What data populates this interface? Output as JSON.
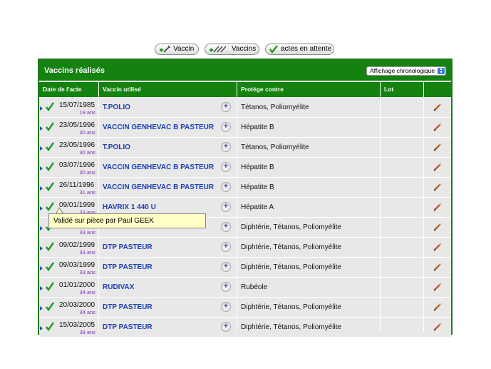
{
  "toolbar": {
    "vaccin_label": "Vaccin",
    "vaccins_label": "Vaccins",
    "attente_label": "actes en attente"
  },
  "panel": {
    "title": "Vaccins réalisés",
    "sort_select": "Affichage chronologique"
  },
  "columns": {
    "date": "Date de l'acte",
    "vaccine": "Vaccin utilisé",
    "protects": "Protège contre",
    "lot": "Lot"
  },
  "rows": [
    {
      "date": "15/07/1985",
      "age": "19 ans",
      "vaccine": "T.POLIO",
      "protects": "Tétanos, Poliomyélite",
      "lot": ""
    },
    {
      "date": "23/05/1996",
      "age": "30 ans",
      "vaccine": "VACCIN GENHEVAC B PASTEUR",
      "protects": "Hépatite B",
      "lot": ""
    },
    {
      "date": "23/05/1996",
      "age": "30 ans",
      "vaccine": "T.POLIO",
      "protects": "Tétanos, Poliomyélite",
      "lot": ""
    },
    {
      "date": "03/07/1996",
      "age": "30 ans",
      "vaccine": "VACCIN GENHEVAC B PASTEUR",
      "protects": "Hépatite B",
      "lot": ""
    },
    {
      "date": "26/11/1996",
      "age": "31 ans",
      "vaccine": "VACCIN GENHEVAC B PASTEUR",
      "protects": "Hépatite B",
      "lot": ""
    },
    {
      "date": "09/01/1999",
      "age": "33 ans",
      "vaccine": "HAVRIX 1 440 U",
      "protects": "Hépatite A",
      "lot": ""
    },
    {
      "date": "",
      "age": "33 ans",
      "vaccine": "",
      "protects": "Diphtérie, Tétanos, Poliomyélite",
      "lot": ""
    },
    {
      "date": "09/02/1999",
      "age": "33 ans",
      "vaccine": "DTP PASTEUR",
      "protects": "Diphtérie, Tétanos, Poliomyélite",
      "lot": ""
    },
    {
      "date": "09/03/1999",
      "age": "33 ans",
      "vaccine": "DTP PASTEUR",
      "protects": "Diphtérie, Tétanos, Poliomyélite",
      "lot": ""
    },
    {
      "date": "01/01/2000",
      "age": "34 ans",
      "vaccine": "RUDIVAX",
      "protects": "Rubéole",
      "lot": ""
    },
    {
      "date": "20/03/2000",
      "age": "34 ans",
      "vaccine": "DTP PASTEUR",
      "protects": "Diphtérie, Tétanos, Poliomyélite",
      "lot": ""
    },
    {
      "date": "15/03/2005",
      "age": "39 ans",
      "vaccine": "DTP PASTEUR",
      "protects": "Diphtérie, Tétanos, Poliomyélite",
      "lot": ""
    }
  ],
  "tooltip": {
    "text": "Validé sur pièce par Paul GEEK"
  },
  "icons": {
    "check": "check-icon",
    "edit": "pencil-icon",
    "plus": "plus-icon",
    "expand": "triangle-right-icon",
    "syringe": "syringe-icon"
  },
  "colors": {
    "header_green": "#14820f",
    "row_bg": "#e8e8e8",
    "vaccine_link": "#1b3fb5",
    "age_text": "#7b2fbe",
    "check_green": "#1e9a1e",
    "tooltip_bg": "#ffffc6"
  }
}
